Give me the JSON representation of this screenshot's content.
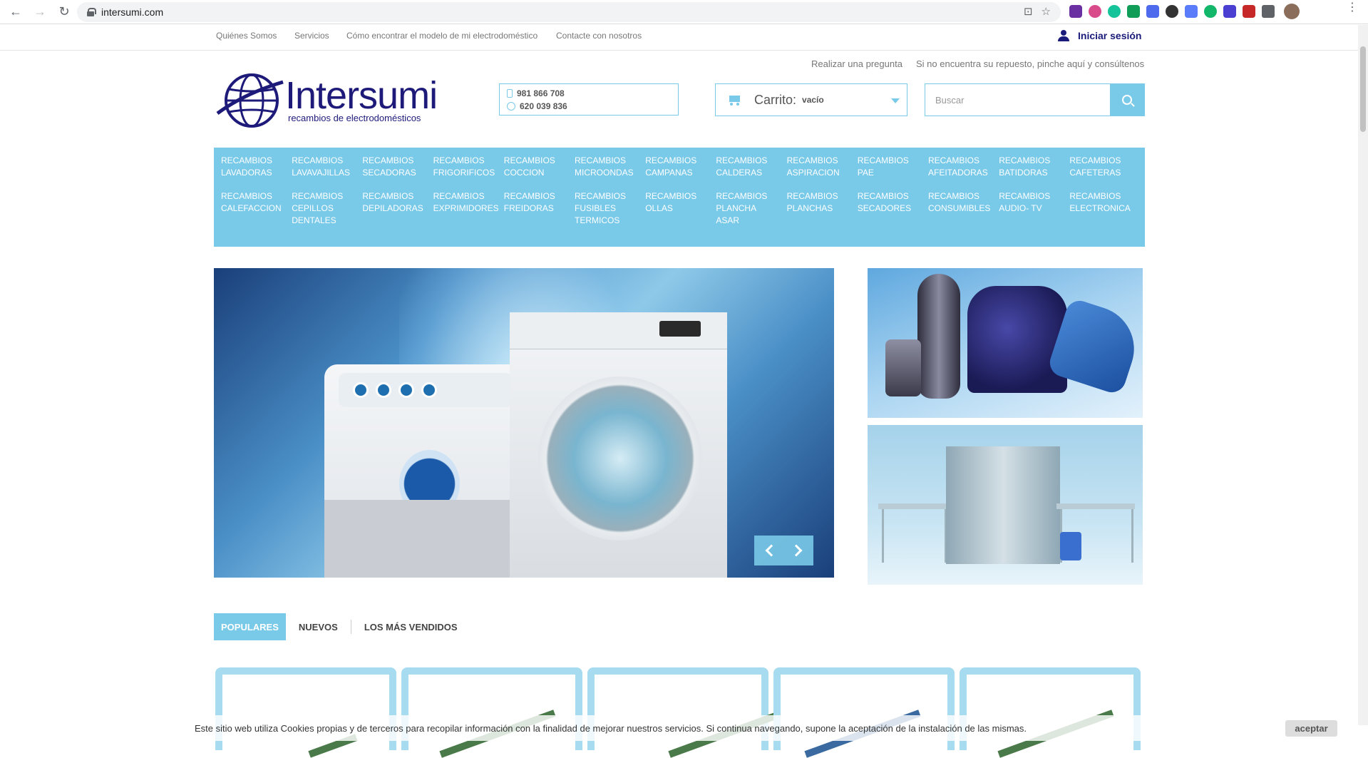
{
  "browser": {
    "url": "intersumi.com",
    "back_icon": "←",
    "forward_icon": "→",
    "reload_icon": "↻",
    "omni_icons": [
      "⊡",
      "☆"
    ]
  },
  "topnav": {
    "links": [
      "Quiénes Somos",
      "Servicios",
      "Cómo encontrar el modelo de mi electrodoméstico",
      "Contacte con nosotros"
    ],
    "login": "Iniciar sesión"
  },
  "help": {
    "ask": "Realizar una pregunta",
    "notfound": "Si no encuentra su repuesto, pinche aquí y consúltenos"
  },
  "logo": {
    "brand": "Intersumi",
    "tagline": "recambios de electrodomésticos"
  },
  "contact": {
    "phone": "981 866 708",
    "whatsapp": "620 039 836"
  },
  "cart": {
    "label": "Carrito:",
    "state": "vacío"
  },
  "search": {
    "placeholder": "Buscar"
  },
  "categories": [
    [
      "RECAMBIOS",
      "LAVADORAS"
    ],
    [
      "RECAMBIOS",
      "LAVAVAJILLAS"
    ],
    [
      "RECAMBIOS",
      "SECADORAS"
    ],
    [
      "RECAMBIOS",
      "FRIGORIFICOS"
    ],
    [
      "RECAMBIOS",
      "COCCION"
    ],
    [
      "RECAMBIOS",
      "MICROONDAS"
    ],
    [
      "RECAMBIOS",
      "CAMPANAS"
    ],
    [
      "RECAMBIOS",
      "CALDERAS"
    ],
    [
      "RECAMBIOS",
      "ASPIRACION"
    ],
    [
      "RECAMBIOS",
      "PAE"
    ],
    [
      "RECAMBIOS",
      "AFEITADORAS"
    ],
    [
      "RECAMBIOS",
      "BATIDORAS"
    ],
    [
      "RECAMBIOS",
      "CAFETERAS"
    ],
    [
      "RECAMBIOS",
      "CALEFACCION"
    ],
    [
      "RECAMBIOS",
      "CEPILLOS",
      "DENTALES"
    ],
    [
      "RECAMBIOS",
      "DEPILADORAS"
    ],
    [
      "RECAMBIOS",
      "EXPRIMIDORES"
    ],
    [
      "RECAMBIOS",
      "FREIDORAS"
    ],
    [
      "RECAMBIOS",
      "FUSIBLES",
      "TERMICOS"
    ],
    [
      "RECAMBIOS",
      "OLLAS"
    ],
    [
      "RECAMBIOS",
      "PLANCHA",
      "ASAR"
    ],
    [
      "RECAMBIOS",
      "PLANCHAS"
    ],
    [
      "RECAMBIOS",
      "SECADORES"
    ],
    [
      "RECAMBIOS",
      "CONSUMIBLES"
    ],
    [
      "RECAMBIOS",
      "AUDIO- TV"
    ],
    [
      "RECAMBIOS",
      "ELECTRONICA"
    ]
  ],
  "tabs": [
    "POPULARES",
    "NUEVOS",
    "LOS MÁS VENDIDOS"
  ],
  "cookie": {
    "message": "Este sitio web utiliza Cookies propias y de terceros para recopilar información con la finalidad de mejorar nuestros servicios. Si continua navegando, supone la aceptación de la instalación de las mismas.",
    "accept": "aceptar"
  },
  "colors": {
    "accent": "#79c9e8",
    "brand": "#1e1a7a"
  }
}
